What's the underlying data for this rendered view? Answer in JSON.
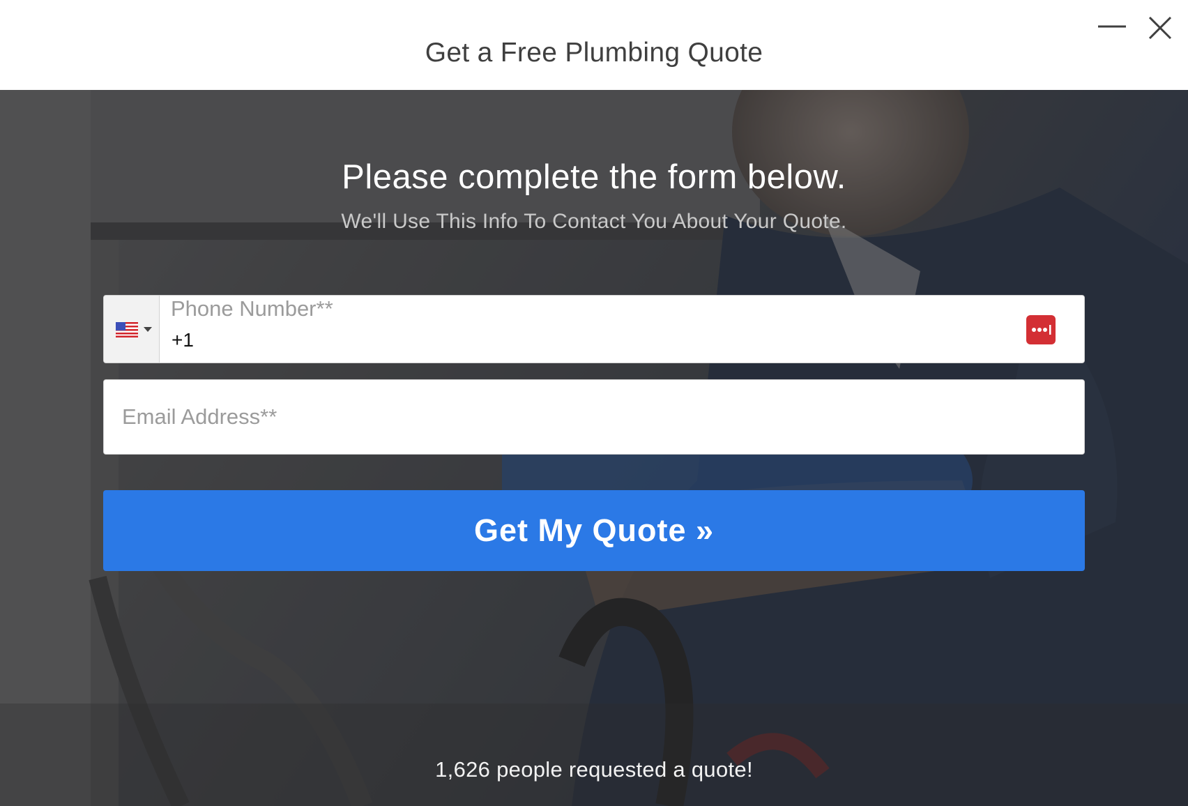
{
  "window": {
    "title": "Get a Free Plumbing Quote",
    "minimize_icon": "minimize-icon",
    "close_icon": "close-icon"
  },
  "form": {
    "heading": "Please complete the form below.",
    "subheading": "We'll Use This Info To Contact You About Your Quote.",
    "phone": {
      "label": "Phone Number**",
      "value": "+1",
      "country_icon": "us-flag-icon",
      "password_manager_icon": "password-manager-icon"
    },
    "email": {
      "placeholder": "Email Address**",
      "value": ""
    },
    "submit_label": "Get My Quote »"
  },
  "footer": {
    "counter_text": "1,626 people requested a quote!"
  },
  "colors": {
    "accent": "#2b79e6",
    "password_icon": "#d32f34",
    "overlay": "#1c1c1e"
  }
}
